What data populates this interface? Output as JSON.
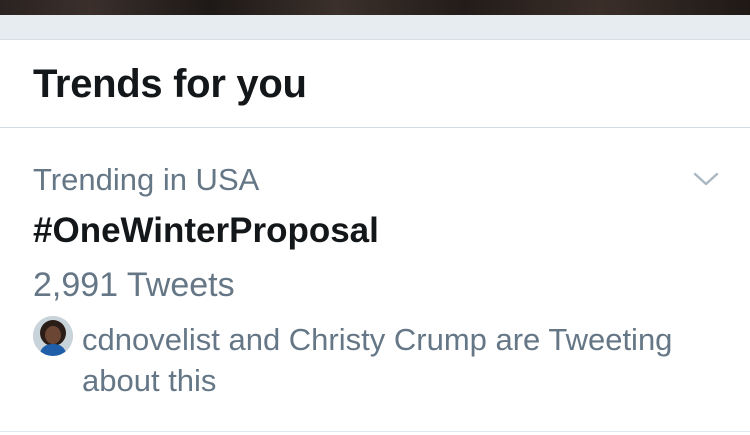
{
  "section": {
    "title": "Trends for you"
  },
  "trend": {
    "context": "Trending in USA",
    "name": "#OneWinterProposal",
    "tweet_count": "2,991 Tweets",
    "social_context": "cdnovelist and Christy Crump are Tweeting about this"
  },
  "colors": {
    "primary_text": "#14171a",
    "secondary_text": "#657786",
    "divider": "#d6dde2",
    "section_gap": "#e6ecf0"
  },
  "icons": {
    "more_options": "chevron-down-icon",
    "avatar": "user-avatar"
  }
}
